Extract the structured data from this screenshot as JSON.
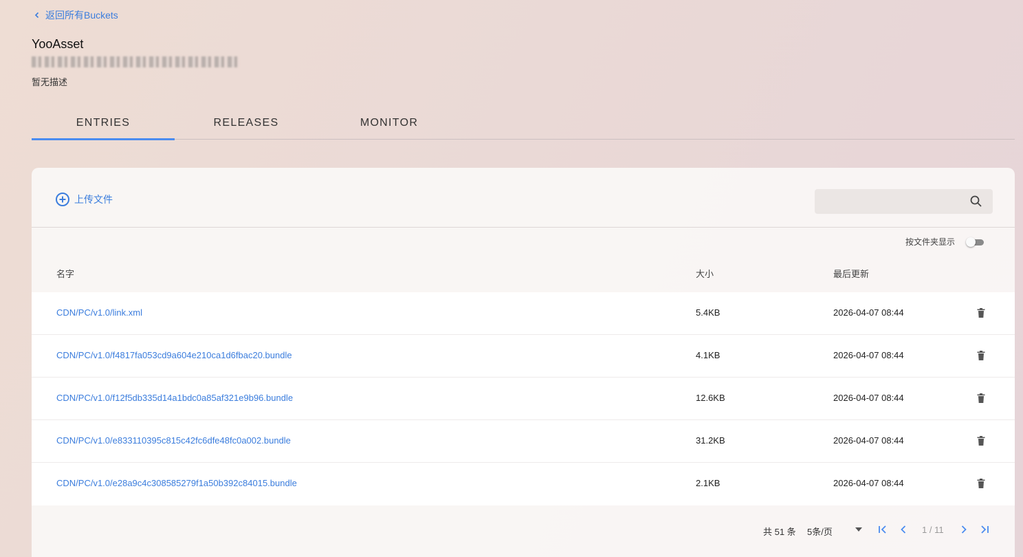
{
  "nav": {
    "back_label": "返回所有Buckets"
  },
  "bucket": {
    "name": "YooAsset",
    "description": "暂无描述"
  },
  "tabs": [
    {
      "label": "ENTRIES",
      "active": true
    },
    {
      "label": "RELEASES",
      "active": false
    },
    {
      "label": "MONITOR",
      "active": false
    }
  ],
  "toolbar": {
    "upload_label": "上传文件",
    "search_placeholder": "",
    "search_icon": "search-icon"
  },
  "folder_view": {
    "label": "按文件夹显示",
    "enabled": false
  },
  "table": {
    "headers": {
      "name": "名字",
      "size": "大小",
      "updated": "最后更新"
    },
    "rows": [
      {
        "name": "CDN/PC/v1.0/link.xml",
        "size": "5.4KB",
        "updated": "2026-04-07 08:44"
      },
      {
        "name": "CDN/PC/v1.0/f4817fa053cd9a604e210ca1d6fbac20.bundle",
        "size": "4.1KB",
        "updated": "2026-04-07 08:44"
      },
      {
        "name": "CDN/PC/v1.0/f12f5db335d14a1bdc0a85af321e9b96.bundle",
        "size": "12.6KB",
        "updated": "2026-04-07 08:44"
      },
      {
        "name": "CDN/PC/v1.0/e833110395c815c42fc6dfe48fc0a002.bundle",
        "size": "31.2KB",
        "updated": "2026-04-07 08:44"
      },
      {
        "name": "CDN/PC/v1.0/e28a9c4c308585279f1a50b392c84015.bundle",
        "size": "2.1KB",
        "updated": "2026-04-07 08:44"
      }
    ]
  },
  "pagination": {
    "total": "共 51 条",
    "per_page": "5条/页",
    "page_info": "1 / 11"
  },
  "colors": {
    "accent": "#4a8cf0",
    "link": "#3b7ddd"
  }
}
